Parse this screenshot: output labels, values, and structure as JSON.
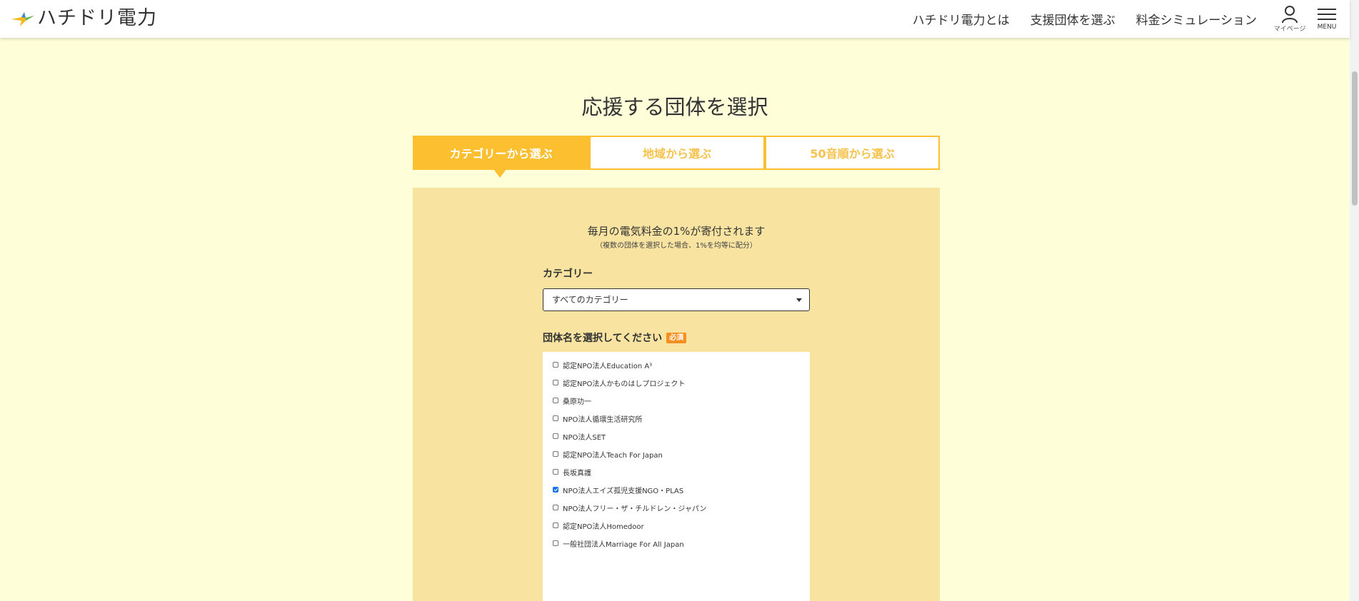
{
  "header": {
    "logo_text": "ハチドリ電力",
    "nav": [
      "ハチドリ電力とは",
      "支援団体を選ぶ",
      "料金シミュレーション"
    ],
    "mypage_label": "マイページ",
    "menu_label": "MENU"
  },
  "page_title": "応援する団体を選択",
  "tabs": [
    {
      "label": "カテゴリーから選ぶ",
      "active": true
    },
    {
      "label": "地域から選ぶ",
      "active": false
    },
    {
      "label": "50音順から選ぶ",
      "active": false
    }
  ],
  "panel": {
    "lead": "毎月の電気料金の1%が寄付されます",
    "sublead": "（複数の団体を選択した場合、1%を均等に配分）",
    "category_label": "カテゴリー",
    "category_value": "すべてのカテゴリー",
    "org_label": "団体名を選択してください",
    "required_badge": "必須"
  },
  "organizations": [
    {
      "name": "認定NPO法人Education A³",
      "checked": false
    },
    {
      "name": "認定NPO法人かものはしプロジェクト",
      "checked": false
    },
    {
      "name": "桑原功一",
      "checked": false
    },
    {
      "name": "NPO法人循環生活研究所",
      "checked": false
    },
    {
      "name": "NPO法人SET",
      "checked": false
    },
    {
      "name": "認定NPO法人Teach For Japan",
      "checked": false
    },
    {
      "name": "長坂真護",
      "checked": false
    },
    {
      "name": "NPO法人エイズ孤児支援NGO・PLAS",
      "checked": true
    },
    {
      "name": "NPO法人フリー・ザ・チルドレン・ジャパン",
      "checked": false
    },
    {
      "name": "認定NPO法人Homedoor",
      "checked": false
    },
    {
      "name": "一般社団法人Marriage For All Japan",
      "checked": false
    }
  ],
  "colors": {
    "background": "#fefed9",
    "accent": "#fbbf30",
    "panel": "#f8e3a1",
    "badge": "#f58f1f"
  }
}
